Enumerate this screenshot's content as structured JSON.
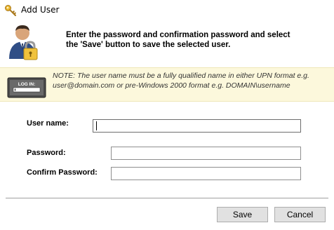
{
  "window": {
    "title": "Add User",
    "icon": "key-icon"
  },
  "header": {
    "icon": "user-lock-icon",
    "line1": "Enter the password and confirmation password and select",
    "line2": "the 'Save' button to save the selected user."
  },
  "note": {
    "icon": "login-screen-icon",
    "icon_text": "LOG IN:",
    "line1": "NOTE:  The user name must be a fully qualified name in either UPN format e.g.",
    "line2": "user@domain.com or pre-Windows 2000 format e.g. DOMAIN\\username",
    "background": "#fcf8dc"
  },
  "form": {
    "username_label": "User name:",
    "username_value": "",
    "password_label": "Password:",
    "password_value": "",
    "confirm_label": "Confirm Password:",
    "confirm_value": ""
  },
  "buttons": {
    "save_label": "Save",
    "cancel_label": "Cancel"
  }
}
